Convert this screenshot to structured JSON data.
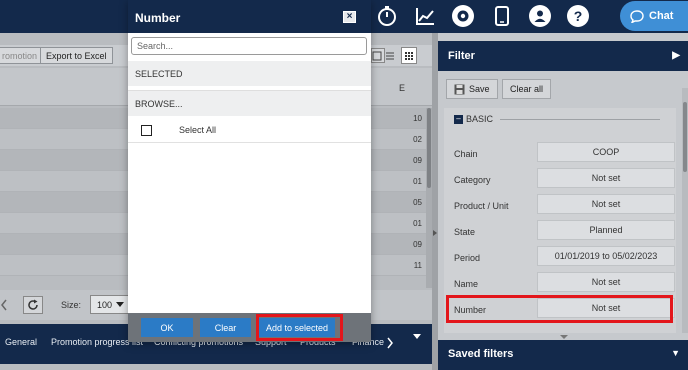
{
  "header": {
    "icons": [
      "timer-icon",
      "chart-icon",
      "gear-icon",
      "tablet-icon",
      "user-icon",
      "help-icon"
    ],
    "chat_label": "Chat",
    "brand_color": "#13294b",
    "accent_color": "#2b7bc6"
  },
  "toolbar": {
    "promotion_label": "romotion",
    "export_label": "Export to Excel"
  },
  "grid": {
    "column_letter": "E",
    "row_values": [
      "10",
      "02",
      "09",
      "01",
      "05",
      "01",
      "09",
      "11"
    ]
  },
  "pager": {
    "size_label": "Size:",
    "size_value": "100"
  },
  "tabs": [
    "General",
    "Promotion progress list",
    "Conflicting promotions",
    "Support",
    "Products",
    "Finance"
  ],
  "filter": {
    "title": "Filter",
    "save_label": "Save",
    "clear_all_label": "Clear all",
    "section_title": "BASIC",
    "fields": [
      {
        "label": "Chain",
        "value": "COOP"
      },
      {
        "label": "Category",
        "value": "Not set"
      },
      {
        "label": "Product / Unit",
        "value": "Not set"
      },
      {
        "label": "State",
        "value": "Planned"
      },
      {
        "label": "Period",
        "value": "01/01/2019 to 05/02/2023"
      },
      {
        "label": "Name",
        "value": "Not set"
      },
      {
        "label": "Number",
        "value": "Not set"
      }
    ],
    "saved_filters_title": "Saved filters"
  },
  "modal": {
    "title": "Number",
    "close_label": "×",
    "search_placeholder": "Search...",
    "selected_label": "SELECTED",
    "browse_label": "BROWSE...",
    "select_all_label": "Select All",
    "ok_label": "OK",
    "clear_label": "Clear",
    "add_label": "Add to selected"
  }
}
